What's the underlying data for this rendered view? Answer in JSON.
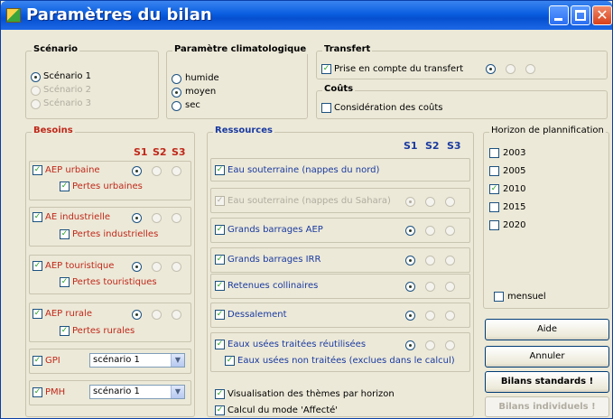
{
  "window": {
    "title": "Paramètres du bilan"
  },
  "scenario": {
    "title": "Scénario",
    "options": [
      "Scénario 1",
      "Scénario 2",
      "Scénario 3"
    ]
  },
  "climat": {
    "title": "Paramètre climatologique",
    "options": [
      "humide",
      "moyen",
      "sec"
    ]
  },
  "transfert": {
    "title": "Transfert",
    "checkbox_label": "Prise en compte du transfert"
  },
  "couts": {
    "title": "Coûts",
    "checkbox_label": "Considération des coûts"
  },
  "besoins": {
    "title": "Besoins",
    "columns": [
      "S1",
      "S2",
      "S3"
    ],
    "items": [
      {
        "label": "AEP urbaine",
        "sub_label": "Pertes urbaines"
      },
      {
        "label": "AE industrielle",
        "sub_label": "Pertes industrielles"
      },
      {
        "label": "AEP touristique",
        "sub_label": "Pertes touristiques"
      },
      {
        "label": "AEP rurale",
        "sub_label": "Pertes rurales"
      }
    ],
    "gpi": {
      "label": "GPI",
      "select_value": "scénario 1"
    },
    "pmh": {
      "label": "PMH",
      "select_value": "scénario 1"
    }
  },
  "ressources": {
    "title": "Ressources",
    "columns": [
      "S1",
      "S2",
      "S3"
    ],
    "items": [
      {
        "label": "Eau souterraine (nappes du nord)"
      },
      {
        "label": "Eau souterraine (nappes du Sahara)"
      },
      {
        "label": "Grands barrages AEP"
      },
      {
        "label": "Grands barrages IRR"
      },
      {
        "label": "Retenues collinaires"
      },
      {
        "label": "Dessalement"
      },
      {
        "label": "Eaux usées traitées réutilisées",
        "sub_label": "Eaux usées non traitées (exclues dans le calcul)"
      }
    ],
    "visualisation_label": "Visualisation des thèmes par horizon",
    "calcul_label": "Calcul du mode 'Affecté'"
  },
  "horizon": {
    "title": "Horizon de plannification",
    "years": [
      "2003",
      "2005",
      "2010",
      "2015",
      "2020"
    ],
    "mensuel_label": "mensuel"
  },
  "buttons": {
    "aide": "Aide",
    "annuler": "Annuler",
    "bilans_standards": "Bilans standards !",
    "bilans_individuels": "Bilans individuels !"
  },
  "colors": {
    "check": "#21a121",
    "besoins_title": "#c0281a",
    "ressources_title": "#1a3aa0",
    "titlebar": "#0a5ee0"
  },
  "icons": {
    "app": "app-icon",
    "minimize": "minimize-icon",
    "maximize": "maximize-icon",
    "close": "close-icon",
    "dropdown": "chevron-down-icon"
  }
}
